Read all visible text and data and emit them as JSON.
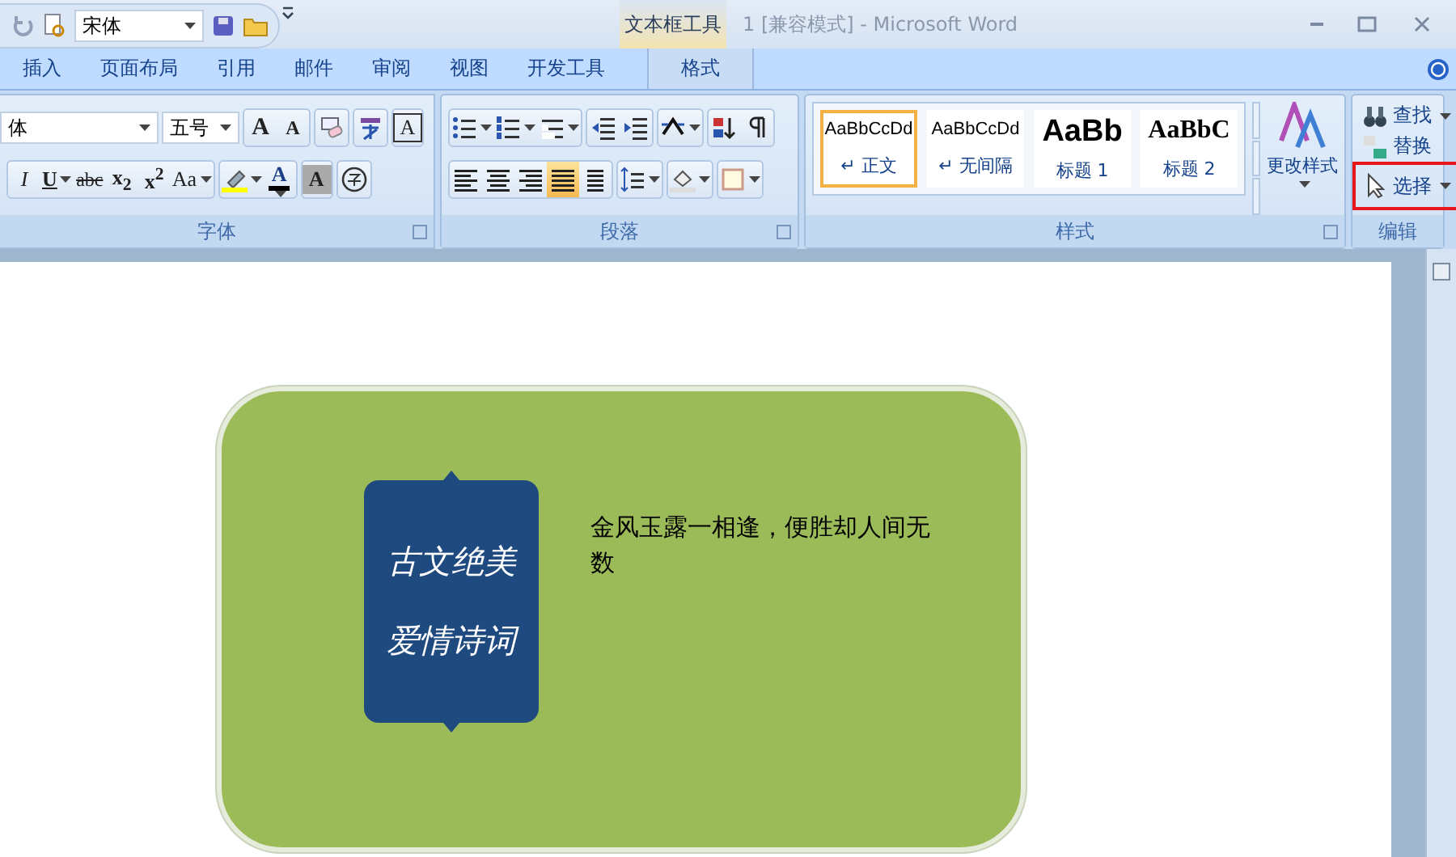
{
  "quick_access": {
    "font_name": "宋体"
  },
  "window": {
    "title": "1 [兼容模式] - Microsoft Word"
  },
  "contextual_tab_group": {
    "label": "文本框工具"
  },
  "tabs": [
    {
      "label": "插入",
      "selected": false
    },
    {
      "label": "页面布局",
      "selected": false
    },
    {
      "label": "引用",
      "selected": false
    },
    {
      "label": "邮件",
      "selected": false
    },
    {
      "label": "审阅",
      "selected": false
    },
    {
      "label": "视图",
      "selected": false
    },
    {
      "label": "开发工具",
      "selected": false
    },
    {
      "label": "格式",
      "selected": false,
      "contextual": true
    }
  ],
  "font_group": {
    "label": "字体",
    "font_name": "体",
    "font_size": "五号",
    "row1": [
      {
        "kind": "grow",
        "label": "A"
      },
      {
        "kind": "shrink",
        "label": "A"
      },
      {
        "kind": "clear"
      },
      {
        "kind": "phonetic"
      },
      {
        "kind": "border",
        "label": "A"
      }
    ],
    "row2": [
      {
        "kind": "italic",
        "label": "I"
      },
      {
        "kind": "underline",
        "label": "U",
        "dropdown": true
      },
      {
        "kind": "strike",
        "label": "abc"
      },
      {
        "kind": "script",
        "label": "x$_{2}$"
      },
      {
        "kind": "script",
        "label": "x$^{2}$"
      },
      {
        "kind": "case",
        "label": "Aa",
        "dropdown": true
      },
      {
        "kind": "highlight",
        "dropdown": true
      },
      {
        "kind": "color",
        "label": "A",
        "dropdown": true
      },
      {
        "kind": "shading",
        "label": "A"
      },
      {
        "kind": "enclosed"
      }
    ]
  },
  "paragraph_group": {
    "label": "段落",
    "row1": [
      {
        "kind": "bullets"
      },
      {
        "kind": "numbering"
      },
      {
        "kind": "multilevel"
      },
      {
        "kind": "outdent"
      },
      {
        "kind": "indent"
      },
      {
        "kind": "layout"
      },
      {
        "kind": "sort"
      },
      {
        "kind": "marks"
      }
    ],
    "align": [
      {
        "kind": "left",
        "selected": false
      },
      {
        "kind": "center",
        "selected": false
      },
      {
        "kind": "right",
        "selected": false
      },
      {
        "kind": "justify",
        "selected": true
      },
      {
        "kind": "distributed",
        "selected": false
      }
    ],
    "row2": [
      {
        "kind": "spacing"
      },
      {
        "kind": "fill"
      },
      {
        "kind": "borders"
      }
    ]
  },
  "styles_group": {
    "label": "样式",
    "change_styles": "更改样式",
    "gallery": [
      {
        "preview": "AaBbCcDd",
        "name": "↵ 正文",
        "kind": "normal",
        "selected": true
      },
      {
        "preview": "AaBbCcDd",
        "name": "↵ 无间隔",
        "kind": "normal",
        "selected": false
      },
      {
        "preview": "AaBb",
        "name": "标题 1",
        "kind": "heading1",
        "selected": false
      },
      {
        "preview": "AaBbC",
        "name": "标题 2",
        "kind": "heading2",
        "selected": false
      }
    ]
  },
  "editing_group": {
    "label": "编辑",
    "items": [
      {
        "kind": "find",
        "label": "查找",
        "dropdown": true,
        "highlighted": false
      },
      {
        "kind": "replace",
        "label": "替换",
        "dropdown": false,
        "highlighted": false
      },
      {
        "kind": "select",
        "label": "选择",
        "dropdown": true,
        "highlighted": true
      }
    ]
  },
  "document": {
    "shape_lines": [
      "古文绝美",
      "爱情诗词"
    ],
    "text": "金风玉露一相逢，便胜却人间无数"
  }
}
